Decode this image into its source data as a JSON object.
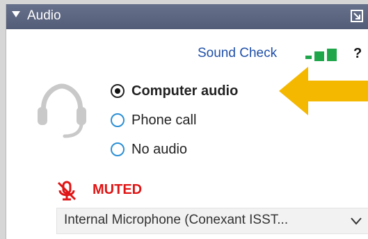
{
  "panel": {
    "title": "Audio",
    "collapse_icon": "triangle-down-icon",
    "popout_icon": "popout-icon"
  },
  "toolbar": {
    "sound_check_label": "Sound Check",
    "signal_icon": "signal-meter-icon",
    "help_label": "?"
  },
  "audio_options": {
    "headset_icon": "headset-icon",
    "items": [
      {
        "label": "Computer audio",
        "selected": true
      },
      {
        "label": "Phone call",
        "selected": false
      },
      {
        "label": "No audio",
        "selected": false
      }
    ]
  },
  "annotation": {
    "arrow_icon": "arrow-left-icon",
    "arrow_color": "#f5b800"
  },
  "mute": {
    "icon": "muted-mic-icon",
    "label": "MUTED",
    "color": "#e01414"
  },
  "microphone": {
    "selected": "Internal Microphone (Conexant ISST...",
    "chevron_icon": "chevron-down-icon"
  },
  "colors": {
    "header_bg": "#5e6680",
    "link": "#1f4fa8",
    "meter": "#1fa64a",
    "radio_border": "#2a8fd6"
  }
}
